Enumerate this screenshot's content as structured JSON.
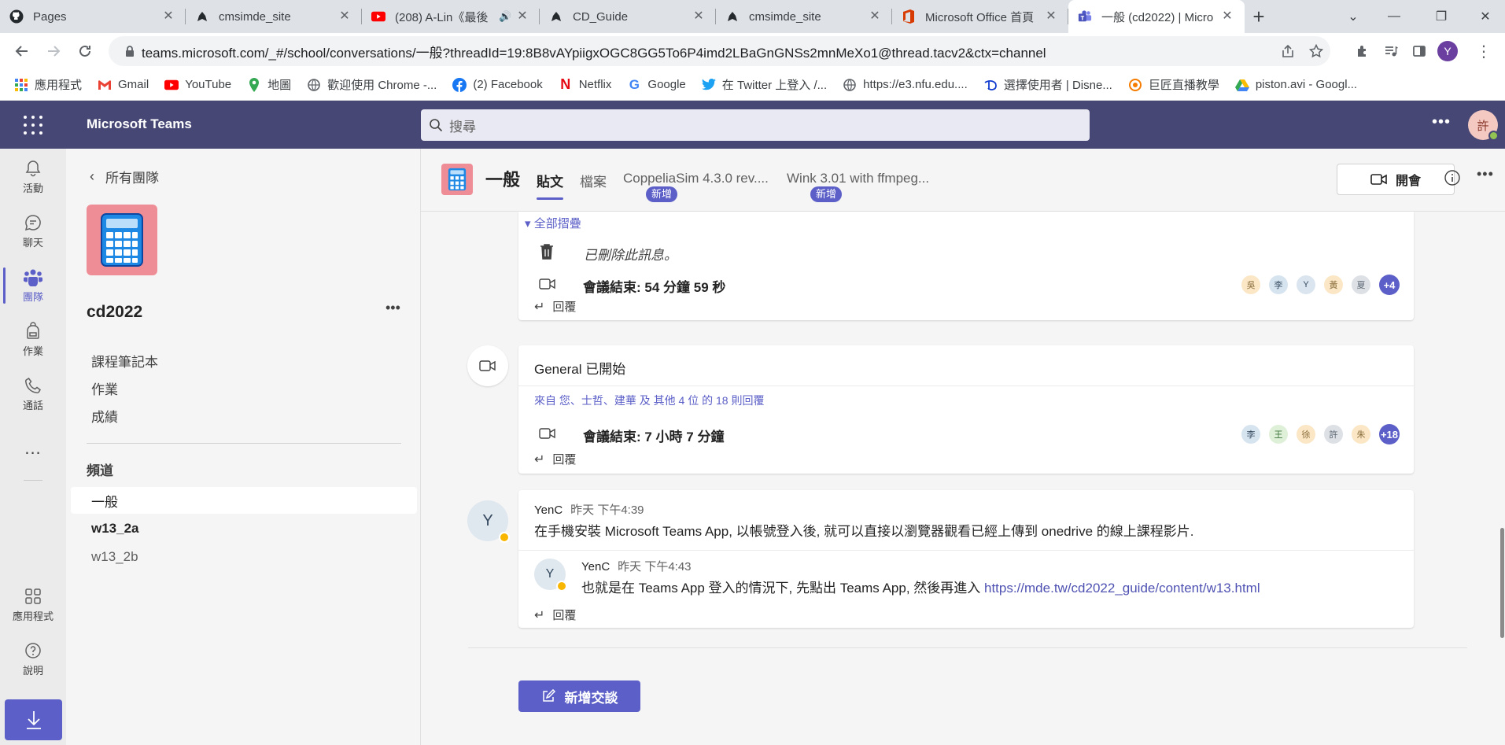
{
  "browser": {
    "tabs": [
      {
        "title": "Pages",
        "icon": "github-icon",
        "active": false
      },
      {
        "title": "cmsimde_site",
        "icon": "github-icon",
        "active": false
      },
      {
        "title": "(208) A-Lin《最後",
        "icon": "youtube-icon",
        "active": false
      },
      {
        "title": "CD_Guide",
        "icon": "github-icon",
        "active": false
      },
      {
        "title": "cmsimde_site",
        "icon": "github-icon",
        "active": false
      },
      {
        "title": "Microsoft Office 首頁",
        "icon": "office-icon",
        "active": false
      },
      {
        "title": "一般 (cd2022) | Micro",
        "icon": "teams-icon",
        "active": true
      }
    ],
    "url": "teams.microsoft.com/_#/school/conversations/一般?threadId=19:8B8vAYpiigxOGC8GG5To6P4imd2LBaGnGNSs2mnMeXo1@thread.tacv2&ctx=channel",
    "profile_initial": "Y",
    "bookmarks": [
      {
        "label": "應用程式",
        "icon": "apps-grid-icon"
      },
      {
        "label": "Gmail",
        "icon": "gmail-icon"
      },
      {
        "label": "YouTube",
        "icon": "youtube-icon"
      },
      {
        "label": "地圖",
        "icon": "maps-icon"
      },
      {
        "label": "歡迎使用 Chrome -...",
        "icon": "globe-icon"
      },
      {
        "label": "(2) Facebook",
        "icon": "facebook-icon"
      },
      {
        "label": "Netflix",
        "icon": "netflix-icon"
      },
      {
        "label": "Google",
        "icon": "google-icon"
      },
      {
        "label": "在 Twitter 上登入 /...",
        "icon": "twitter-icon"
      },
      {
        "label": "https://e3.nfu.edu....",
        "icon": "globe-icon"
      },
      {
        "label": "選擇使用者 | Disne...",
        "icon": "disney-icon"
      },
      {
        "label": "巨匠直播教學",
        "icon": "live-icon"
      },
      {
        "label": "piston.avi - Googl...",
        "icon": "drive-icon"
      }
    ]
  },
  "teams": {
    "app_name": "Microsoft Teams",
    "search_placeholder": "搜尋",
    "user_initial": "許",
    "rail": [
      {
        "label": "活動",
        "icon": "bell-icon",
        "active": false
      },
      {
        "label": "聊天",
        "icon": "chat-icon",
        "active": false
      },
      {
        "label": "團隊",
        "icon": "teams-icon",
        "active": true
      },
      {
        "label": "作業",
        "icon": "backpack-icon",
        "active": false
      },
      {
        "label": "通話",
        "icon": "phone-icon",
        "active": false
      }
    ],
    "rail_more": "...",
    "rail_bottom": [
      {
        "label": "應用程式",
        "icon": "apps-icon"
      },
      {
        "label": "說明",
        "icon": "help-icon"
      }
    ]
  },
  "team_panel": {
    "back_label": "所有團隊",
    "team_name": "cd2022",
    "links": [
      "課程筆記本",
      "作業",
      "成績"
    ],
    "channels_header": "頻道",
    "channels": [
      {
        "name": "一般",
        "state": "active"
      },
      {
        "name": "w13_2a",
        "state": "bold"
      },
      {
        "name": "w13_2b",
        "state": "dim"
      }
    ]
  },
  "channel": {
    "title": "一般",
    "tabs": [
      {
        "label": "貼文",
        "active": true,
        "badge": ""
      },
      {
        "label": "檔案",
        "active": false,
        "badge": ""
      },
      {
        "label": "CoppeliaSim 4.3.0 rev....",
        "active": false,
        "badge": "新增"
      },
      {
        "label": "Wink 3.01 with ffmpeg...",
        "active": false,
        "badge": "新增"
      }
    ],
    "meet_label": "開會"
  },
  "posts": {
    "thread1": {
      "collapse_label": "全部摺疊",
      "deleted_text": "已刪除此訊息。",
      "meeting_end": "會議結束: 54 分鐘 59 秒",
      "participants": [
        {
          "initial": "吳",
          "bg": "#fbe7c6",
          "fg": "#8a6d3b"
        },
        {
          "initial": "李",
          "bg": "#d6e4f0",
          "fg": "#34495e"
        },
        {
          "initial": "Y",
          "bg": "#dbe5ef",
          "fg": "#34495e"
        },
        {
          "initial": "黃",
          "bg": "#fbe7c6",
          "fg": "#8a6d3b"
        },
        {
          "initial": "夏",
          "bg": "#dde1e6",
          "fg": "#5a6470"
        }
      ],
      "more_count": "+4",
      "reply_label": "回覆"
    },
    "thread2": {
      "title": "General 已開始",
      "replies_summary": "來自 您、士哲、建華 及 其他 4 位 的 18 則回覆",
      "meeting_end": "會議結束: 7 小時 7 分鐘",
      "participants": [
        {
          "initial": "李",
          "bg": "#d6e4f0",
          "fg": "#34495e"
        },
        {
          "initial": "王",
          "bg": "#dff0d8",
          "fg": "#3c763d"
        },
        {
          "initial": "徐",
          "bg": "#fbe7c6",
          "fg": "#8a6d3b"
        },
        {
          "initial": "許",
          "bg": "#dde1e6",
          "fg": "#5a6470"
        },
        {
          "initial": "朱",
          "bg": "#fbe7c6",
          "fg": "#8a6d3b"
        }
      ],
      "more_count": "+18",
      "reply_label": "回覆"
    },
    "thread3": {
      "author": "YenC",
      "time": "昨天 下午4:39",
      "avatar": "Y",
      "text": "在手機安裝 Microsoft Teams App, 以帳號登入後, 就可以直接以瀏覽器觀看已經上傳到 onedrive 的線上課程影片.",
      "reply": {
        "author": "YenC",
        "time": "昨天 下午4:43",
        "avatar": "Y",
        "text": "也就是在 Teams App 登入的情況下, 先點出 Teams App, 然後再進入 ",
        "link": "https://mde.tw/cd2022_guide/content/w13.html"
      },
      "reply_label": "回覆"
    }
  },
  "new_conversation_label": "新增交談"
}
